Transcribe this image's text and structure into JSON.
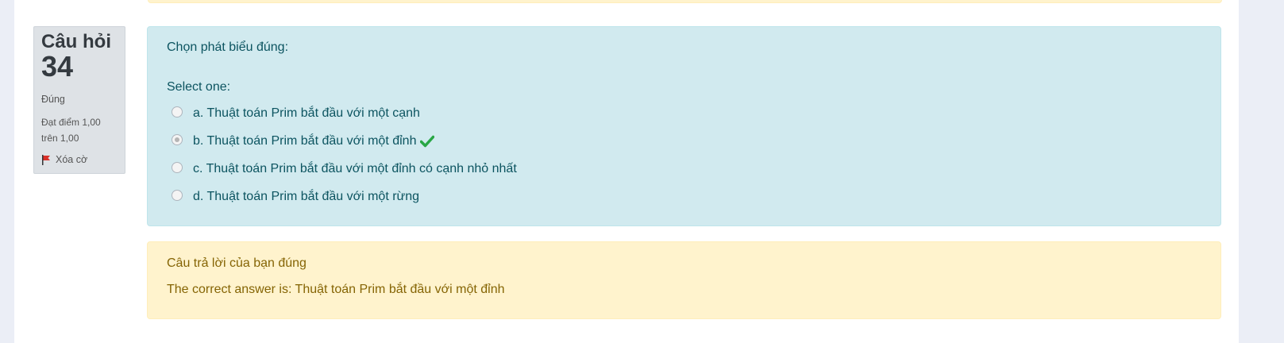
{
  "question": {
    "label": "Câu hỏi",
    "number": "34",
    "state": "Đúng",
    "grade": "Đạt điểm 1,00 trên 1,00",
    "flag_label": "Xóa cờ",
    "text": "Chọn phát biểu đúng:",
    "prompt": "Select one:",
    "options": [
      {
        "label": "a. Thuật toán Prim bắt đầu với một cạnh",
        "selected": false
      },
      {
        "label": "b. Thuật toán Prim bắt đầu với một đỉnh",
        "selected": true,
        "correct_icon": "check-icon"
      },
      {
        "label": "c. Thuật toán Prim bắt đầu với một đỉnh có cạnh nhỏ nhất",
        "selected": false
      },
      {
        "label": "d. Thuật toán Prim bắt đầu với một rừng",
        "selected": false
      }
    ]
  },
  "outcome": {
    "feedback": "Câu trả lời của bạn đúng",
    "correct_answer": "The correct answer is: Thuật toán Prim bắt đầu với một đỉnh"
  },
  "colors": {
    "formulation_bg": "#d1eaef",
    "outcome_bg": "#fff3cd",
    "check_green": "#28a745",
    "flag_red": "#d9302a"
  }
}
